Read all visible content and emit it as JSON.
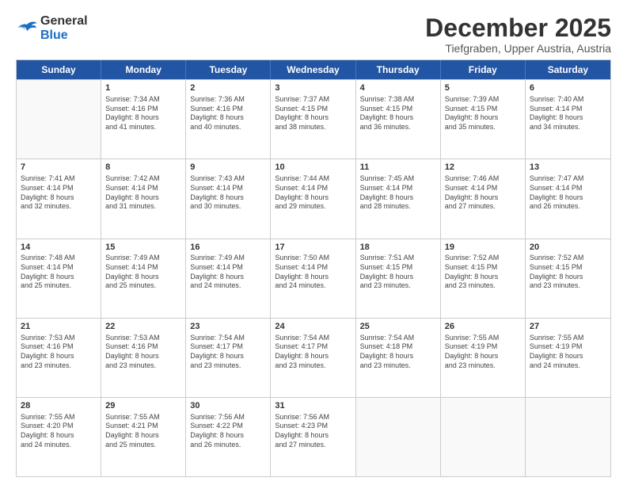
{
  "header": {
    "logo_general": "General",
    "logo_blue": "Blue",
    "month_title": "December 2025",
    "location": "Tiefgraben, Upper Austria, Austria"
  },
  "weekdays": [
    "Sunday",
    "Monday",
    "Tuesday",
    "Wednesday",
    "Thursday",
    "Friday",
    "Saturday"
  ],
  "rows": [
    [
      {
        "day": "",
        "empty": true
      },
      {
        "day": "1",
        "line1": "Sunrise: 7:34 AM",
        "line2": "Sunset: 4:16 PM",
        "line3": "Daylight: 8 hours",
        "line4": "and 41 minutes."
      },
      {
        "day": "2",
        "line1": "Sunrise: 7:36 AM",
        "line2": "Sunset: 4:16 PM",
        "line3": "Daylight: 8 hours",
        "line4": "and 40 minutes."
      },
      {
        "day": "3",
        "line1": "Sunrise: 7:37 AM",
        "line2": "Sunset: 4:15 PM",
        "line3": "Daylight: 8 hours",
        "line4": "and 38 minutes."
      },
      {
        "day": "4",
        "line1": "Sunrise: 7:38 AM",
        "line2": "Sunset: 4:15 PM",
        "line3": "Daylight: 8 hours",
        "line4": "and 36 minutes."
      },
      {
        "day": "5",
        "line1": "Sunrise: 7:39 AM",
        "line2": "Sunset: 4:15 PM",
        "line3": "Daylight: 8 hours",
        "line4": "and 35 minutes."
      },
      {
        "day": "6",
        "line1": "Sunrise: 7:40 AM",
        "line2": "Sunset: 4:14 PM",
        "line3": "Daylight: 8 hours",
        "line4": "and 34 minutes."
      }
    ],
    [
      {
        "day": "7",
        "line1": "Sunrise: 7:41 AM",
        "line2": "Sunset: 4:14 PM",
        "line3": "Daylight: 8 hours",
        "line4": "and 32 minutes."
      },
      {
        "day": "8",
        "line1": "Sunrise: 7:42 AM",
        "line2": "Sunset: 4:14 PM",
        "line3": "Daylight: 8 hours",
        "line4": "and 31 minutes."
      },
      {
        "day": "9",
        "line1": "Sunrise: 7:43 AM",
        "line2": "Sunset: 4:14 PM",
        "line3": "Daylight: 8 hours",
        "line4": "and 30 minutes."
      },
      {
        "day": "10",
        "line1": "Sunrise: 7:44 AM",
        "line2": "Sunset: 4:14 PM",
        "line3": "Daylight: 8 hours",
        "line4": "and 29 minutes."
      },
      {
        "day": "11",
        "line1": "Sunrise: 7:45 AM",
        "line2": "Sunset: 4:14 PM",
        "line3": "Daylight: 8 hours",
        "line4": "and 28 minutes."
      },
      {
        "day": "12",
        "line1": "Sunrise: 7:46 AM",
        "line2": "Sunset: 4:14 PM",
        "line3": "Daylight: 8 hours",
        "line4": "and 27 minutes."
      },
      {
        "day": "13",
        "line1": "Sunrise: 7:47 AM",
        "line2": "Sunset: 4:14 PM",
        "line3": "Daylight: 8 hours",
        "line4": "and 26 minutes."
      }
    ],
    [
      {
        "day": "14",
        "line1": "Sunrise: 7:48 AM",
        "line2": "Sunset: 4:14 PM",
        "line3": "Daylight: 8 hours",
        "line4": "and 25 minutes."
      },
      {
        "day": "15",
        "line1": "Sunrise: 7:49 AM",
        "line2": "Sunset: 4:14 PM",
        "line3": "Daylight: 8 hours",
        "line4": "and 25 minutes."
      },
      {
        "day": "16",
        "line1": "Sunrise: 7:49 AM",
        "line2": "Sunset: 4:14 PM",
        "line3": "Daylight: 8 hours",
        "line4": "and 24 minutes."
      },
      {
        "day": "17",
        "line1": "Sunrise: 7:50 AM",
        "line2": "Sunset: 4:14 PM",
        "line3": "Daylight: 8 hours",
        "line4": "and 24 minutes."
      },
      {
        "day": "18",
        "line1": "Sunrise: 7:51 AM",
        "line2": "Sunset: 4:15 PM",
        "line3": "Daylight: 8 hours",
        "line4": "and 23 minutes."
      },
      {
        "day": "19",
        "line1": "Sunrise: 7:52 AM",
        "line2": "Sunset: 4:15 PM",
        "line3": "Daylight: 8 hours",
        "line4": "and 23 minutes."
      },
      {
        "day": "20",
        "line1": "Sunrise: 7:52 AM",
        "line2": "Sunset: 4:15 PM",
        "line3": "Daylight: 8 hours",
        "line4": "and 23 minutes."
      }
    ],
    [
      {
        "day": "21",
        "line1": "Sunrise: 7:53 AM",
        "line2": "Sunset: 4:16 PM",
        "line3": "Daylight: 8 hours",
        "line4": "and 23 minutes."
      },
      {
        "day": "22",
        "line1": "Sunrise: 7:53 AM",
        "line2": "Sunset: 4:16 PM",
        "line3": "Daylight: 8 hours",
        "line4": "and 23 minutes."
      },
      {
        "day": "23",
        "line1": "Sunrise: 7:54 AM",
        "line2": "Sunset: 4:17 PM",
        "line3": "Daylight: 8 hours",
        "line4": "and 23 minutes."
      },
      {
        "day": "24",
        "line1": "Sunrise: 7:54 AM",
        "line2": "Sunset: 4:17 PM",
        "line3": "Daylight: 8 hours",
        "line4": "and 23 minutes."
      },
      {
        "day": "25",
        "line1": "Sunrise: 7:54 AM",
        "line2": "Sunset: 4:18 PM",
        "line3": "Daylight: 8 hours",
        "line4": "and 23 minutes."
      },
      {
        "day": "26",
        "line1": "Sunrise: 7:55 AM",
        "line2": "Sunset: 4:19 PM",
        "line3": "Daylight: 8 hours",
        "line4": "and 23 minutes."
      },
      {
        "day": "27",
        "line1": "Sunrise: 7:55 AM",
        "line2": "Sunset: 4:19 PM",
        "line3": "Daylight: 8 hours",
        "line4": "and 24 minutes."
      }
    ],
    [
      {
        "day": "28",
        "line1": "Sunrise: 7:55 AM",
        "line2": "Sunset: 4:20 PM",
        "line3": "Daylight: 8 hours",
        "line4": "and 24 minutes."
      },
      {
        "day": "29",
        "line1": "Sunrise: 7:55 AM",
        "line2": "Sunset: 4:21 PM",
        "line3": "Daylight: 8 hours",
        "line4": "and 25 minutes."
      },
      {
        "day": "30",
        "line1": "Sunrise: 7:56 AM",
        "line2": "Sunset: 4:22 PM",
        "line3": "Daylight: 8 hours",
        "line4": "and 26 minutes."
      },
      {
        "day": "31",
        "line1": "Sunrise: 7:56 AM",
        "line2": "Sunset: 4:23 PM",
        "line3": "Daylight: 8 hours",
        "line4": "and 27 minutes."
      },
      {
        "day": "",
        "empty": true
      },
      {
        "day": "",
        "empty": true
      },
      {
        "day": "",
        "empty": true
      }
    ]
  ]
}
